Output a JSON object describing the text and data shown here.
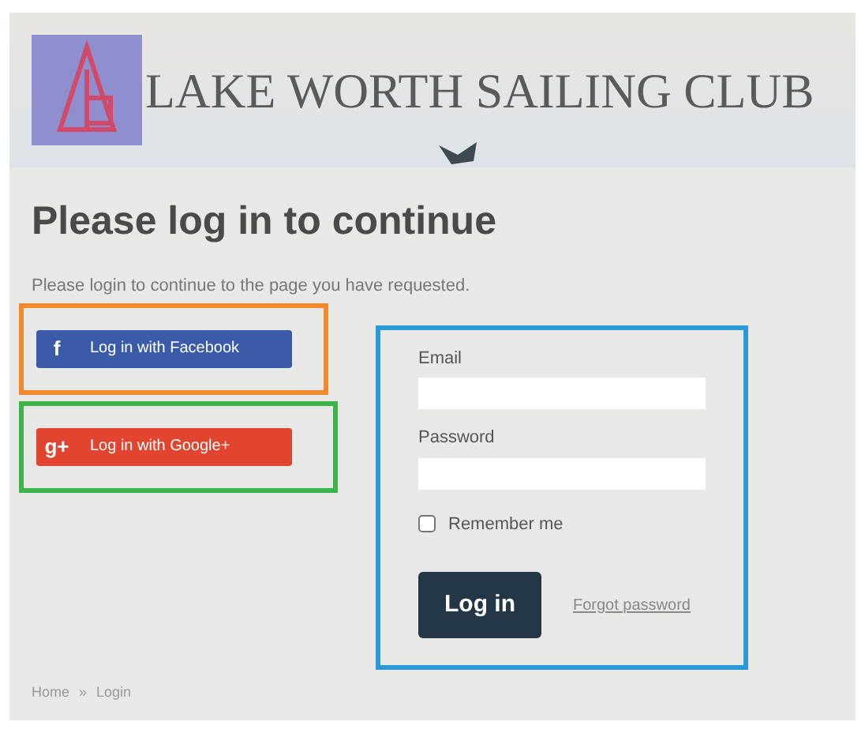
{
  "header": {
    "title": "LAKE WORTH SAILING CLUB"
  },
  "heading": "Please log in to continue",
  "intro": "Please login to continue to the page you have requested.",
  "social_buttons": [
    {
      "kind": "facebook",
      "icon": "f",
      "label": "Log in with Facebook"
    },
    {
      "kind": "google",
      "icon": "g+",
      "label": "Log in with Google+"
    }
  ],
  "form": {
    "fields": [
      {
        "label": "Email"
      },
      {
        "label": "Password"
      }
    ],
    "remember": {
      "label": "Remember me",
      "checked": false
    },
    "submit": "Log in",
    "forgot_link": "Forgot password"
  },
  "breadcrumb": [
    {
      "label": "Home"
    },
    {
      "label": "Login"
    }
  ],
  "breadcrumb_separator": "»"
}
